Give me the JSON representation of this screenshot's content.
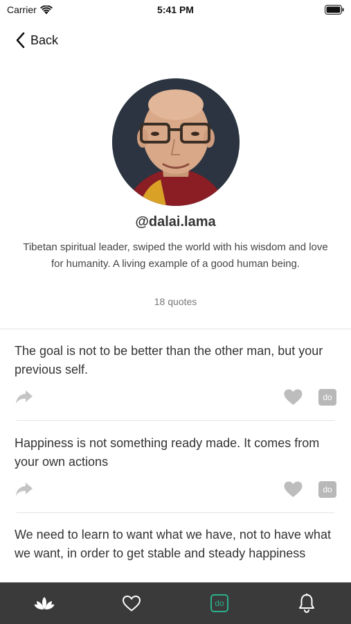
{
  "status_bar": {
    "carrier": "Carrier",
    "time": "5:41 PM"
  },
  "nav": {
    "back_label": "Back"
  },
  "profile": {
    "avatar_icon": "profile-photo",
    "username": "@dalai.lama",
    "bio": "Tibetan spiritual leader, swiped the world with his wisdom and love for humanity. A living example of a good human being.",
    "quote_count": "18 quotes"
  },
  "quotes": [
    {
      "text": "The goal is not to be better than the other man, but your previous self.",
      "do_label": "do"
    },
    {
      "text": "Happiness is not something ready made. It comes from your own actions",
      "do_label": "do"
    },
    {
      "text": "We need to learn to want what we have, not to have what we want, in order to get stable and steady happiness",
      "do_label": "do"
    }
  ],
  "tab_bar": {
    "tabs": [
      {
        "icon": "lotus-icon",
        "active": false
      },
      {
        "icon": "heart-outline-icon",
        "active": false
      },
      {
        "icon": "do-icon",
        "label": "do",
        "active": true
      },
      {
        "icon": "bell-icon",
        "active": false
      }
    ]
  },
  "colors": {
    "accent": "#2ab08a",
    "tab_bar_bg": "#3a3a3a",
    "icon_gray": "#b8b8b8"
  }
}
